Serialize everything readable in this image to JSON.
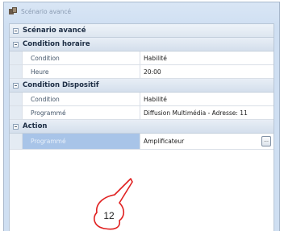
{
  "window": {
    "title": "Scénario avancé"
  },
  "root": {
    "label": "Scénario avancé"
  },
  "sections": [
    {
      "label": "Condition horaire",
      "rows": [
        {
          "name": "Condition",
          "value": "Habilité"
        },
        {
          "name": "Heure",
          "value": "20:00"
        }
      ]
    },
    {
      "label": "Condition Dispositif",
      "rows": [
        {
          "name": "Condition",
          "value": "Habilité"
        },
        {
          "name": "Programmé",
          "value": "Diffusion Multimédia - Adresse: 11"
        }
      ]
    },
    {
      "label": "Action",
      "rows": [
        {
          "name": "Programmé",
          "value": "Amplificateur",
          "button": "..."
        }
      ]
    }
  ],
  "callout": {
    "number": "12"
  },
  "colors": {
    "accent": "#e02020",
    "selection": "#a8c4e8"
  }
}
